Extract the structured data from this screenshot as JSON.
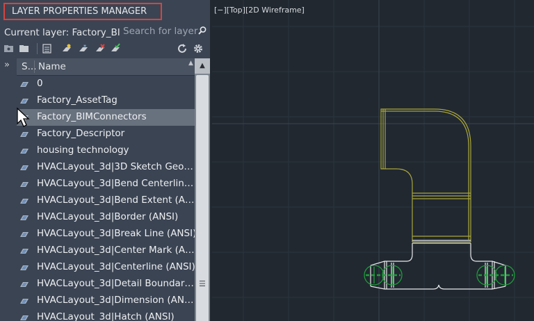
{
  "panel": {
    "title": "LAYER PROPERTIES MANAGER",
    "current_layer": "Current layer: Factory_BIM",
    "search_placeholder": "Search for layer",
    "toolbar_icons": [
      "new-property-filter-icon",
      "new-group-filter-icon",
      "layer-states-manager-icon",
      "new-layer-icon",
      "new-layer-vp-frozen-icon",
      "delete-layer-icon",
      "set-current-icon",
      "refresh-icon",
      "settings-icon"
    ]
  },
  "columns": {
    "status": "S...",
    "name": "Name"
  },
  "layers": [
    {
      "name": "0",
      "selected": false
    },
    {
      "name": "Factory_AssetTag",
      "selected": false
    },
    {
      "name": "Factory_BIMConnectors",
      "selected": true
    },
    {
      "name": "Factory_Descriptor",
      "selected": false
    },
    {
      "name": "housing technology",
      "selected": false
    },
    {
      "name": "HVACLayout_3d|3D Sketch Geo…",
      "selected": false
    },
    {
      "name": "HVACLayout_3d|Bend Centerlin…",
      "selected": false
    },
    {
      "name": "HVACLayout_3d|Bend Extent (A…",
      "selected": false
    },
    {
      "name": "HVACLayout_3d|Border (ANSI)",
      "selected": false
    },
    {
      "name": "HVACLayout_3d|Break Line (ANSI)",
      "selected": false
    },
    {
      "name": "HVACLayout_3d|Center Mark (A…",
      "selected": false
    },
    {
      "name": "HVACLayout_3d|Centerline (ANSI)",
      "selected": false
    },
    {
      "name": "HVACLayout_3d|Detail Boundar…",
      "selected": false
    },
    {
      "name": "HVACLayout_3d|Dimension (AN…",
      "selected": false
    },
    {
      "name": "HVACLayout_3d|Hatch (ANSI)",
      "selected": false
    }
  ],
  "viewport": {
    "label": "[−][Top][2D Wireframe]"
  },
  "colors": {
    "panel_bg": "#3b4453",
    "viewport_bg": "#212830",
    "highlight_border": "#d9433d",
    "selected_row": "#68717e",
    "duct_yellow": "#a9a63a",
    "connector_green": "#1e9e3a"
  }
}
